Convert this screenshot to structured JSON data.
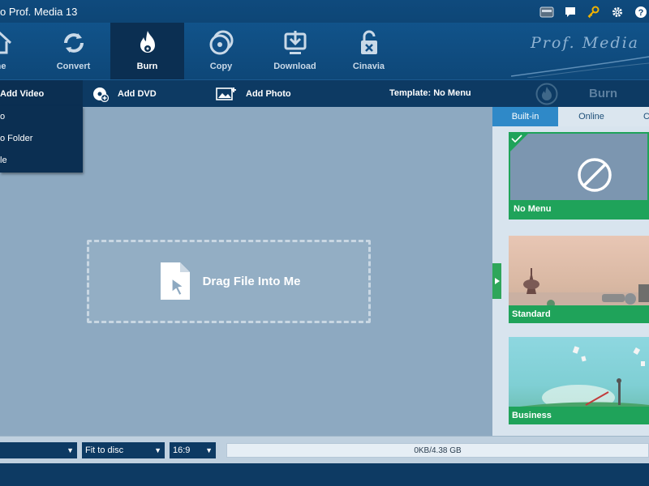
{
  "titlebar": {
    "title": "o Prof. Media 13"
  },
  "nav": {
    "items": [
      {
        "label": "me",
        "icon": "home-icon"
      },
      {
        "label": "Convert",
        "icon": "convert-icon"
      },
      {
        "label": "Burn",
        "icon": "burn-icon"
      },
      {
        "label": "Copy",
        "icon": "copy-icon"
      },
      {
        "label": "Download",
        "icon": "download-icon"
      },
      {
        "label": "Cinavia",
        "icon": "cinavia-icon"
      }
    ],
    "active": "Burn",
    "brand": "Prof. Media"
  },
  "actions": {
    "add_video": "Add Video",
    "add_dvd": "Add DVD",
    "add_photo": "Add Photo",
    "template": "Template: No Menu",
    "burn": "Burn"
  },
  "dropdown": {
    "items": [
      "o",
      "o Folder",
      "le"
    ]
  },
  "main": {
    "drop_label": "Drag File Into Me"
  },
  "panel": {
    "tabs": [
      "Built-in",
      "Online",
      "C"
    ],
    "templates": [
      {
        "label": "No Menu",
        "selected": true
      },
      {
        "label": "Standard"
      },
      {
        "label": "Business"
      }
    ]
  },
  "bottom": {
    "fit": "Fit to disc",
    "aspect": "16:9",
    "capacity": "0KB/4.38 GB"
  },
  "colors": {
    "accent_green": "#1fa35a",
    "dark_blue": "#0d3a63",
    "tab_blue": "#2f89c8"
  }
}
